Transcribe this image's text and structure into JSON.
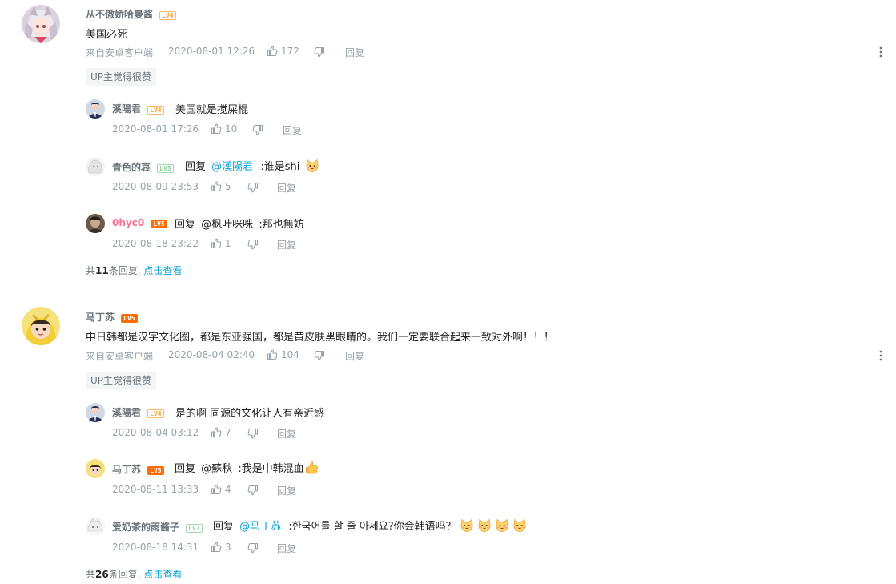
{
  "threads": [
    {
      "main": {
        "username": "从不傲娇哈曼酱",
        "level": "LV4",
        "text": "美国必死",
        "source": "来自安卓客户端",
        "time": "2020-08-01 12:26",
        "likes": "172",
        "reply_label": "回复",
        "up_tag": "UP主觉得很赞"
      },
      "replies": [
        {
          "username": "溪陽君",
          "level": "LV4",
          "text": "美国就是搅屎棍",
          "time": "2020-08-01 17:26",
          "likes": "10",
          "reply_label": "回复"
        },
        {
          "username": "青色的哀",
          "level": "LV3",
          "prefix": "回复",
          "at": "@漢陽君",
          "text": ":谁是shi",
          "time": "2020-08-09 23:53",
          "likes": "5",
          "reply_label": "回复"
        },
        {
          "username": "0hyc0",
          "level": "LV5",
          "prefix": "回复",
          "at": "@枫叶咪咪",
          "text": ":那也無妨",
          "time": "2020-08-18 23:22",
          "likes": "1",
          "reply_label": "回复"
        }
      ],
      "footer": {
        "prefix": "共",
        "count": "11",
        "suffix": "条回复,",
        "view": "点击查看"
      }
    },
    {
      "main": {
        "username": "马丁苏",
        "level": "LV5",
        "text": "中日韩都是汉字文化圈，都是东亚强国，都是黄皮肤黑眼睛的。我们一定要联合起来一致对外啊！！！",
        "source": "来自安卓客户端",
        "time": "2020-08-04 02:40",
        "likes": "104",
        "reply_label": "回复",
        "up_tag": "UP主觉得很赞"
      },
      "replies": [
        {
          "username": "溪陽君",
          "level": "LV4",
          "text": "是的啊 同源的文化让人有亲近感",
          "time": "2020-08-04 03:12",
          "likes": "7",
          "reply_label": "回复"
        },
        {
          "username": "马丁苏",
          "level": "LV5",
          "prefix": "回复",
          "at": "@蘇秋",
          "text": ":我是中韩混血",
          "time": "2020-08-11 13:33",
          "likes": "4",
          "reply_label": "回复"
        },
        {
          "username": "爱奶茶的雨酱子",
          "level": "LV3",
          "prefix": "回复",
          "at": "@马丁苏",
          "text": ":한국어를 할 줄 아세요?你会韩语吗？",
          "time": "2020-08-18 14:31",
          "likes": "3",
          "reply_label": "回复"
        }
      ],
      "footer": {
        "prefix": "共",
        "count": "26",
        "suffix": "条回复,",
        "view": "点击查看"
      }
    }
  ],
  "icons": {
    "like": "thumbs-up-icon",
    "dislike": "thumbs-down-icon",
    "more": "more-vertical-icon",
    "emoji_cat": "cat-face-emoji",
    "emoji_thumb": "thumbs-up-emoji"
  },
  "colors": {
    "link": "#00a1d6",
    "meta": "#99a2aa",
    "username": "#6d757a",
    "vip_username": "#fb7299",
    "level5": "#ff6c00"
  }
}
